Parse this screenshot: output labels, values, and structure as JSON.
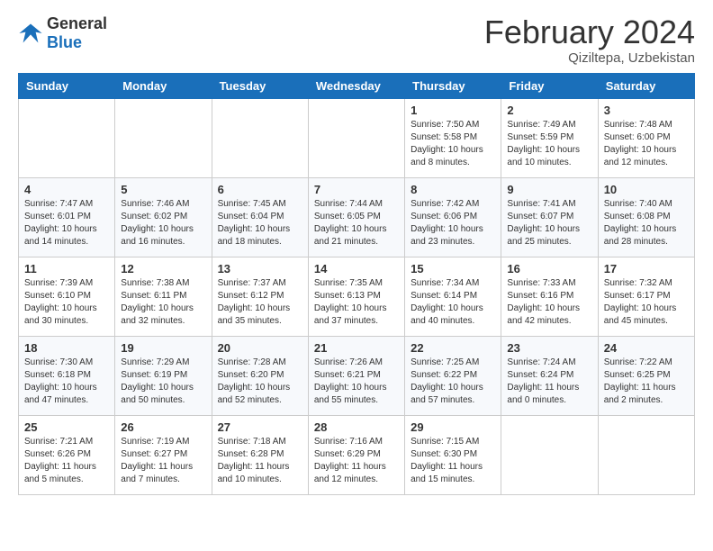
{
  "header": {
    "logo_general": "General",
    "logo_blue": "Blue",
    "month_year": "February 2024",
    "location": "Qiziltepa, Uzbekistan"
  },
  "calendar": {
    "weekdays": [
      "Sunday",
      "Monday",
      "Tuesday",
      "Wednesday",
      "Thursday",
      "Friday",
      "Saturday"
    ],
    "weeks": [
      [
        {
          "day": "",
          "info": ""
        },
        {
          "day": "",
          "info": ""
        },
        {
          "day": "",
          "info": ""
        },
        {
          "day": "",
          "info": ""
        },
        {
          "day": "1",
          "info": "Sunrise: 7:50 AM\nSunset: 5:58 PM\nDaylight: 10 hours and 8 minutes."
        },
        {
          "day": "2",
          "info": "Sunrise: 7:49 AM\nSunset: 5:59 PM\nDaylight: 10 hours and 10 minutes."
        },
        {
          "day": "3",
          "info": "Sunrise: 7:48 AM\nSunset: 6:00 PM\nDaylight: 10 hours and 12 minutes."
        }
      ],
      [
        {
          "day": "4",
          "info": "Sunrise: 7:47 AM\nSunset: 6:01 PM\nDaylight: 10 hours and 14 minutes."
        },
        {
          "day": "5",
          "info": "Sunrise: 7:46 AM\nSunset: 6:02 PM\nDaylight: 10 hours and 16 minutes."
        },
        {
          "day": "6",
          "info": "Sunrise: 7:45 AM\nSunset: 6:04 PM\nDaylight: 10 hours and 18 minutes."
        },
        {
          "day": "7",
          "info": "Sunrise: 7:44 AM\nSunset: 6:05 PM\nDaylight: 10 hours and 21 minutes."
        },
        {
          "day": "8",
          "info": "Sunrise: 7:42 AM\nSunset: 6:06 PM\nDaylight: 10 hours and 23 minutes."
        },
        {
          "day": "9",
          "info": "Sunrise: 7:41 AM\nSunset: 6:07 PM\nDaylight: 10 hours and 25 minutes."
        },
        {
          "day": "10",
          "info": "Sunrise: 7:40 AM\nSunset: 6:08 PM\nDaylight: 10 hours and 28 minutes."
        }
      ],
      [
        {
          "day": "11",
          "info": "Sunrise: 7:39 AM\nSunset: 6:10 PM\nDaylight: 10 hours and 30 minutes."
        },
        {
          "day": "12",
          "info": "Sunrise: 7:38 AM\nSunset: 6:11 PM\nDaylight: 10 hours and 32 minutes."
        },
        {
          "day": "13",
          "info": "Sunrise: 7:37 AM\nSunset: 6:12 PM\nDaylight: 10 hours and 35 minutes."
        },
        {
          "day": "14",
          "info": "Sunrise: 7:35 AM\nSunset: 6:13 PM\nDaylight: 10 hours and 37 minutes."
        },
        {
          "day": "15",
          "info": "Sunrise: 7:34 AM\nSunset: 6:14 PM\nDaylight: 10 hours and 40 minutes."
        },
        {
          "day": "16",
          "info": "Sunrise: 7:33 AM\nSunset: 6:16 PM\nDaylight: 10 hours and 42 minutes."
        },
        {
          "day": "17",
          "info": "Sunrise: 7:32 AM\nSunset: 6:17 PM\nDaylight: 10 hours and 45 minutes."
        }
      ],
      [
        {
          "day": "18",
          "info": "Sunrise: 7:30 AM\nSunset: 6:18 PM\nDaylight: 10 hours and 47 minutes."
        },
        {
          "day": "19",
          "info": "Sunrise: 7:29 AM\nSunset: 6:19 PM\nDaylight: 10 hours and 50 minutes."
        },
        {
          "day": "20",
          "info": "Sunrise: 7:28 AM\nSunset: 6:20 PM\nDaylight: 10 hours and 52 minutes."
        },
        {
          "day": "21",
          "info": "Sunrise: 7:26 AM\nSunset: 6:21 PM\nDaylight: 10 hours and 55 minutes."
        },
        {
          "day": "22",
          "info": "Sunrise: 7:25 AM\nSunset: 6:22 PM\nDaylight: 10 hours and 57 minutes."
        },
        {
          "day": "23",
          "info": "Sunrise: 7:24 AM\nSunset: 6:24 PM\nDaylight: 11 hours and 0 minutes."
        },
        {
          "day": "24",
          "info": "Sunrise: 7:22 AM\nSunset: 6:25 PM\nDaylight: 11 hours and 2 minutes."
        }
      ],
      [
        {
          "day": "25",
          "info": "Sunrise: 7:21 AM\nSunset: 6:26 PM\nDaylight: 11 hours and 5 minutes."
        },
        {
          "day": "26",
          "info": "Sunrise: 7:19 AM\nSunset: 6:27 PM\nDaylight: 11 hours and 7 minutes."
        },
        {
          "day": "27",
          "info": "Sunrise: 7:18 AM\nSunset: 6:28 PM\nDaylight: 11 hours and 10 minutes."
        },
        {
          "day": "28",
          "info": "Sunrise: 7:16 AM\nSunset: 6:29 PM\nDaylight: 11 hours and 12 minutes."
        },
        {
          "day": "29",
          "info": "Sunrise: 7:15 AM\nSunset: 6:30 PM\nDaylight: 11 hours and 15 minutes."
        },
        {
          "day": "",
          "info": ""
        },
        {
          "day": "",
          "info": ""
        }
      ]
    ]
  }
}
